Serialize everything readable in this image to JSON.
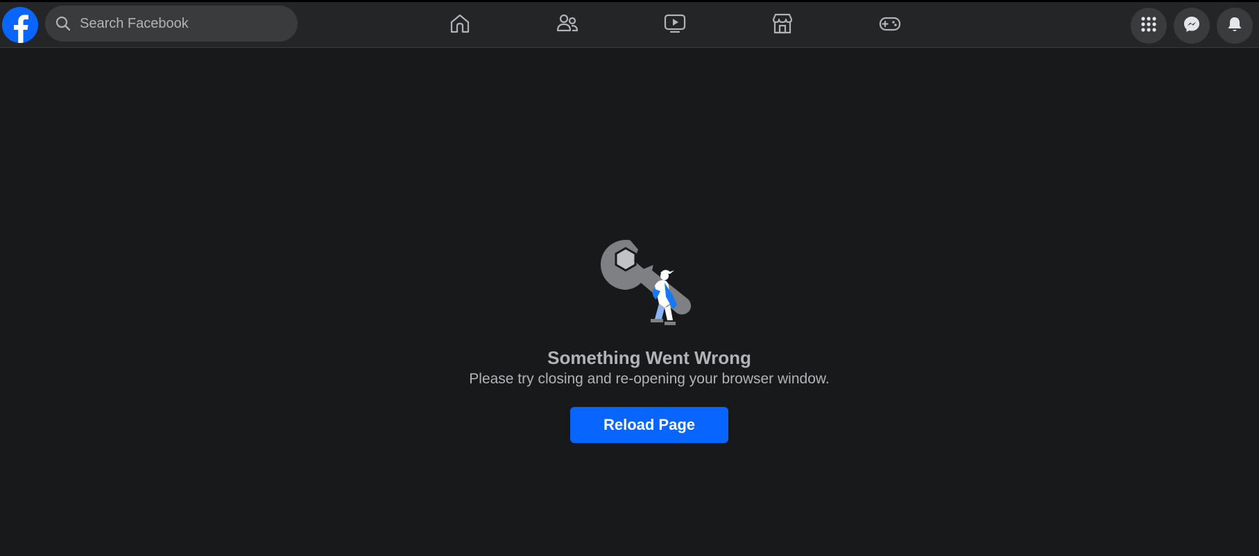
{
  "header": {
    "logo_icon": "facebook-logo",
    "search": {
      "placeholder": "Search Facebook"
    },
    "tabs": [
      {
        "name": "home",
        "icon": "home-icon"
      },
      {
        "name": "friends",
        "icon": "friends-icon"
      },
      {
        "name": "watch",
        "icon": "video-icon"
      },
      {
        "name": "marketplace",
        "icon": "marketplace-icon"
      },
      {
        "name": "gaming",
        "icon": "gaming-icon"
      }
    ],
    "right_buttons": [
      {
        "name": "menu",
        "icon": "grid-menu-icon"
      },
      {
        "name": "messenger",
        "icon": "messenger-icon"
      },
      {
        "name": "notifications",
        "icon": "bell-icon"
      }
    ]
  },
  "error": {
    "illustration": "wrench-person-illustration",
    "title": "Something Went Wrong",
    "message": "Please try closing and re-opening your browser window.",
    "button_label": "Reload Page"
  },
  "colors": {
    "page_bg": "#18191a",
    "navbar_bg": "#242526",
    "accent": "#0866ff",
    "text_secondary": "#b0b3b8"
  }
}
